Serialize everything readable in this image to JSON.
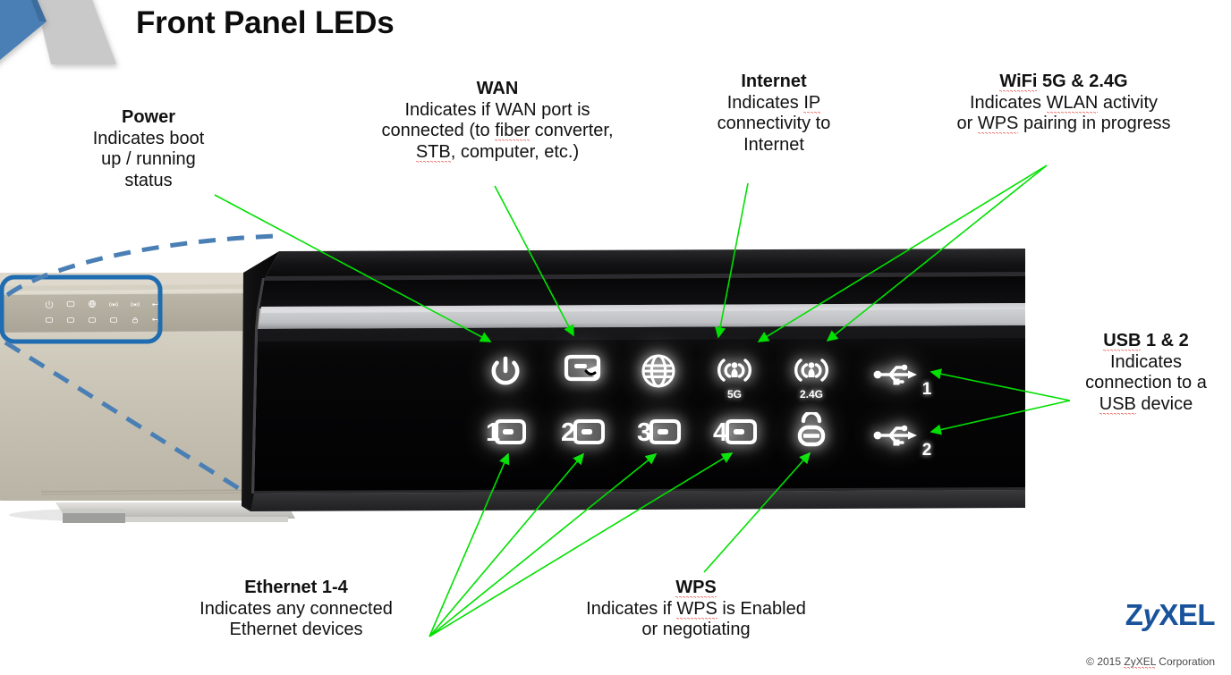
{
  "page": {
    "title": "Front Panel LEDs",
    "background": "#ffffff",
    "accent_blue": "#4a7fb5",
    "arrow_green": "#00e000",
    "callout_blue": "#1f6cb0"
  },
  "callouts": [
    {
      "id": "power",
      "heading": "Power",
      "lines": [
        "Indicates boot",
        "up / running",
        "status"
      ],
      "misspelled": []
    },
    {
      "id": "wan",
      "heading": "WAN",
      "lines": [
        "Indicates if WAN port is",
        "connected (to fiber converter,",
        "STB, computer, etc.)"
      ],
      "misspelled": [
        "fiber",
        "STB"
      ]
    },
    {
      "id": "internet",
      "heading": "Internet",
      "lines": [
        "Indicates IP",
        "connectivity to",
        "Internet"
      ],
      "misspelled": [
        "IP"
      ]
    },
    {
      "id": "wifi",
      "heading": "WiFi 5G & 2.4G",
      "lines": [
        "Indicates WLAN activity",
        "or WPS pairing in progress"
      ],
      "misspelled": [
        "WiFi",
        "WLAN",
        "WPS"
      ]
    },
    {
      "id": "usb",
      "heading": "USB 1 & 2",
      "lines": [
        "Indicates",
        "connection to a",
        "USB device"
      ],
      "misspelled": [
        "USB"
      ]
    },
    {
      "id": "ethernet",
      "heading": "Ethernet 1-4",
      "lines": [
        "Indicates any connected",
        "Ethernet devices"
      ],
      "misspelled": []
    },
    {
      "id": "wps",
      "heading": "WPS",
      "lines": [
        "Indicates if WPS is Enabled",
        "or negotiating"
      ],
      "misspelled": [
        "WPS",
        "WPS"
      ]
    }
  ],
  "leds": {
    "row_top": [
      {
        "name": "power-led",
        "icon": "power-icon",
        "sublabel": ""
      },
      {
        "name": "wan-led",
        "icon": "wan-port-icon",
        "sublabel": ""
      },
      {
        "name": "internet-led",
        "icon": "globe-icon",
        "sublabel": ""
      },
      {
        "name": "wifi-5g-led",
        "icon": "wifi-icon",
        "sublabel": "5G"
      },
      {
        "name": "wifi-24g-led",
        "icon": "wifi-icon",
        "sublabel": "2.4G"
      },
      {
        "name": "usb1-led",
        "icon": "usb-icon",
        "sublabel": "1"
      }
    ],
    "row_bottom": [
      {
        "name": "ethernet1-led",
        "icon": "lan-port-icon",
        "sublabel": "1"
      },
      {
        "name": "ethernet2-led",
        "icon": "lan-port-icon",
        "sublabel": "2"
      },
      {
        "name": "ethernet3-led",
        "icon": "lan-port-icon",
        "sublabel": "3"
      },
      {
        "name": "ethernet4-led",
        "icon": "lan-port-icon",
        "sublabel": "4"
      },
      {
        "name": "wps-led",
        "icon": "wps-lock-icon",
        "sublabel": ""
      },
      {
        "name": "usb2-led",
        "icon": "usb-icon",
        "sublabel": "2"
      }
    ]
  },
  "branding": {
    "logo_upper_z": "Z",
    "logo_lower_y": "y",
    "logo_xel": "XEL",
    "logo_text": "ZyXEL",
    "copyright": "© 2015 ZyXEL Corporation",
    "copyright_misspelled": "ZyXEL",
    "logo_color": "#18539b"
  },
  "device_inset": {
    "label": "router-front-photo",
    "highlight_box_color": "#1f6cb0",
    "dashed_line_color": "#4a7fb5"
  }
}
